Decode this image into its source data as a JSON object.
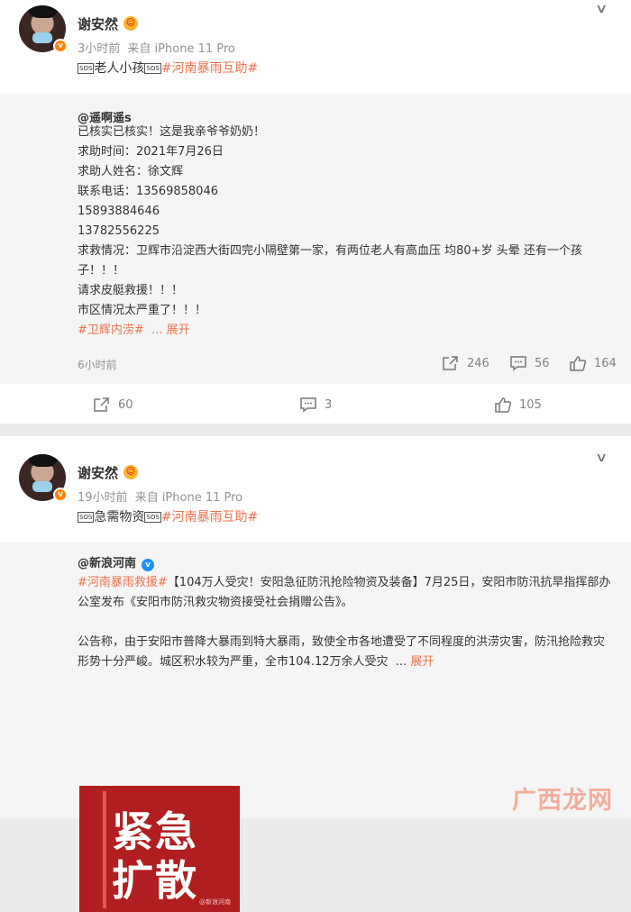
{
  "posts": [
    {
      "username": "谢安然",
      "time": "3小时前",
      "source": "来自 iPhone 11 Pro",
      "text_before_tag": "老人小孩",
      "sos": "SOS",
      "tag": "#河南暴雨互助#",
      "repost": {
        "author": "@遥啊遥s",
        "lines": [
          "已核实已核实！这是我亲爷爷奶奶！",
          "求助时间：2021年7月26日",
          "求助人姓名：徐文辉",
          "联系电话：13569858046",
          "15893884646",
          "13782556225",
          "求救情况：卫辉市沿淀西大街四完小隔壁第一家，有两位老人有高血压 均80+岁 头晕 还有一个孩",
          "子！！！",
          "请求皮艇救援！！！",
          "市区情况太严重了！！！"
        ],
        "tag": "#卫辉内涝#",
        "more": "... 展开",
        "time": "6小时前",
        "reposts": "246",
        "comments": "56",
        "likes": "164"
      },
      "actions": {
        "reposts": "60",
        "comments": "3",
        "likes": "105"
      }
    },
    {
      "username": "谢安然",
      "time": "19小时前",
      "source": "来自 iPhone 11 Pro",
      "text_before_tag": "急需物资",
      "sos": "SOS",
      "tag": "#河南暴雨互助#",
      "repost": {
        "author": "@新浪河南",
        "tag": "#河南暴雨救援#",
        "line1_rest": "【104万人受灾！安阳急征防汛抢险物资及装备】7月25日，安阳市防汛抗旱指挥部办",
        "line2": "公室发布《安阳市防汛救灾物资接受社会捐赠公告》。",
        "line3": "公告称，由于安阳市普降大暴雨到特大暴雨，致使全市各地遭受了不同程度的洪涝灾害，防汛抢险救灾",
        "line4": "形势十分严峻。城区积水较为严重，全市104.12万余人受灾",
        "more_dots": "...",
        "more": "展开",
        "poster_text": "紧急扩散",
        "poster_watermark": "@新浪河南"
      }
    }
  ],
  "site_watermark": "广西龙网",
  "icons": {
    "verified_badge": "v-badge-icon",
    "chevron": "chevron-down-icon",
    "repost": "repost-icon",
    "comment": "comment-icon",
    "like": "thumbs-up-icon"
  },
  "colors": {
    "tag": "#eb7350",
    "verified": "#ff8200",
    "blue_v": "#1e90ff",
    "meta": "#939393"
  }
}
